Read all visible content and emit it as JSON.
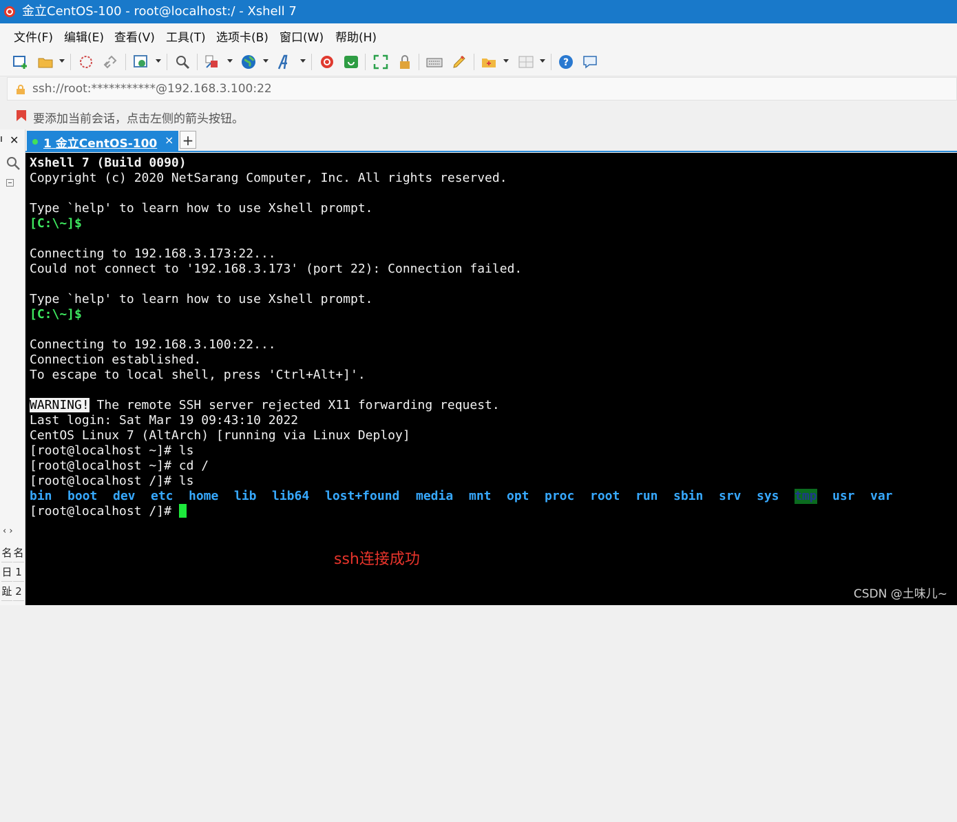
{
  "window": {
    "title": "金立CentOS-100 - root@localhost:/ - Xshell 7"
  },
  "menu": [
    "文件(F)",
    "编辑(E)",
    "查看(V)",
    "工具(T)",
    "选项卡(B)",
    "窗口(W)",
    "帮助(H)"
  ],
  "toolbar_icons": [
    "new-session-icon",
    "open-folder-icon",
    "disconnect-icon",
    "reconnect-icon",
    "properties-icon",
    "find-icon",
    "transfer-icon",
    "globe-icon",
    "font-icon",
    "xftp-icon",
    "xagent-icon",
    "fullscreen-icon",
    "lock-icon",
    "keyboard-icon",
    "highlight-icon",
    "new-folder-icon",
    "layout-icon",
    "help-icon",
    "chat-icon"
  ],
  "address": {
    "text": "ssh://root:***********@192.168.3.100:22"
  },
  "hint": {
    "text": "要添加当前会话，点击左侧的箭头按钮。"
  },
  "tabs": [
    {
      "number": "1",
      "label": "金立CentOS-100",
      "close": "×"
    }
  ],
  "sidepanel": {
    "nav": "‹  ›",
    "grid": [
      "名",
      "名",
      "日",
      "1",
      "趾",
      "2"
    ]
  },
  "terminal": {
    "lines": [
      "Xshell 7 (Build 0090)",
      "Copyright (c) 2020 NetSarang Computer, Inc. All rights reserved.",
      "",
      "Type `help' to learn how to use Xshell prompt.",
      "[C:\\~]$",
      "",
      "Connecting to 192.168.3.173:22...",
      "Could not connect to '192.168.3.173' (port 22): Connection failed.",
      "",
      "Type `help' to learn how to use Xshell prompt.",
      "[C:\\~]$",
      "",
      "Connecting to 192.168.3.100:22...",
      "Connection established.",
      "To escape to local shell, press 'Ctrl+Alt+]'.",
      "",
      "",
      "Last login: Sat Mar 19 09:43:10 2022",
      "CentOS Linux 7 (AltArch) [running via Linux Deploy]",
      "[root@localhost ~]# ls",
      "[root@localhost ~]# cd /",
      "[root@localhost /]# ls"
    ],
    "warning_tag": "WARNING!",
    "warning_rest": " The remote SSH server rejected X11 forwarding request.",
    "dirs": [
      "bin",
      "boot",
      "dev",
      "etc",
      "home",
      "lib",
      "lib64",
      "lost+found",
      "media",
      "mnt",
      "opt",
      "proc",
      "root",
      "run",
      "sbin",
      "srv",
      "sys",
      "tmp",
      "usr",
      "var"
    ],
    "final_prompt": "[root@localhost /]# "
  },
  "annotation": "ssh连接成功",
  "watermark": "CSDN @土味儿~",
  "colors": {
    "titlebar": "#1979ca",
    "prompt_green": "#3ee85f",
    "dir_blue": "#37a9ff",
    "annotation_red": "#e8342b"
  }
}
